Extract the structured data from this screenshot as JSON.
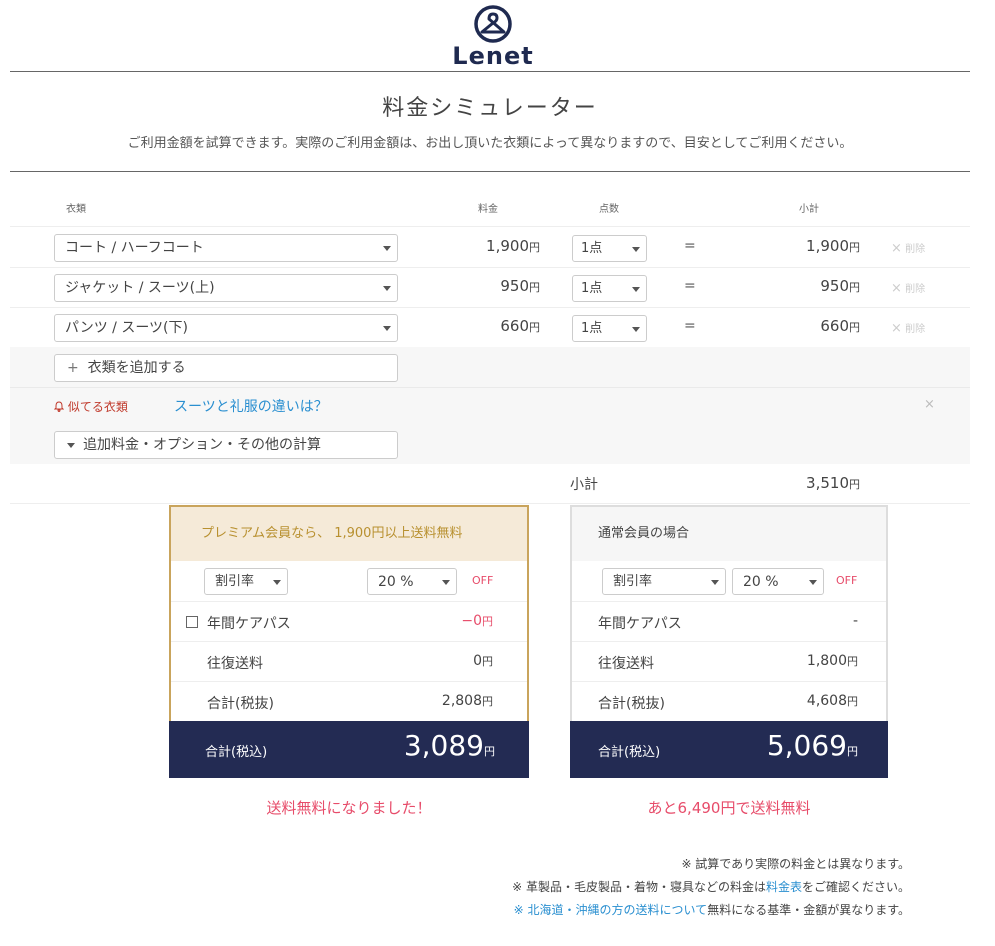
{
  "brand": {
    "name": "Lenet"
  },
  "page": {
    "title": "料金シミュレーター",
    "subtitle": "ご利用金額を試算できます。実際のご利用金額は、お出し頂いた衣類によって異なりますので、目安としてご利用ください。"
  },
  "table": {
    "headers": {
      "item": "衣類",
      "price": "料金",
      "count": "点数",
      "subtotal": "小計"
    },
    "rows": [
      {
        "item": "コート / ハーフコート",
        "price": "1,900",
        "count": "1点",
        "subtotal": "1,900"
      },
      {
        "item": "ジャケット / スーツ(上)",
        "price": "950",
        "count": "1点",
        "subtotal": "950"
      },
      {
        "item": "パンツ / スーツ(下)",
        "price": "660",
        "count": "1点",
        "subtotal": "660"
      }
    ],
    "equals": "=",
    "yen": "円",
    "delete_label": "削除",
    "delete_x": "×"
  },
  "add_item": {
    "plus": "+",
    "label": "衣類を追加する"
  },
  "similar": {
    "label": "似てる衣類",
    "link": "スーツと礼服の違いは？",
    "close": "×"
  },
  "additional": {
    "label": "追加料金・オプション・その他の計算"
  },
  "subtotal": {
    "label": "小計",
    "value": "3,510"
  },
  "premium": {
    "header": "プレミアム会員なら、 1,900円以上送料無料",
    "discount_label": "割引率",
    "discount_value": "20 %",
    "off": "OFF",
    "care_pass_label": "年間ケアパス",
    "care_pass_value": "−0",
    "shipping_label": "往復送料",
    "shipping_value": "0",
    "total_ex_label": "合計(税抜)",
    "total_ex_value": "2,808",
    "total_in_label": "合計(税込)",
    "total_in_value": "3,089",
    "message": "送料無料になりました！"
  },
  "normal": {
    "header": "通常会員の場合",
    "discount_label": "割引率",
    "discount_value": "20 %",
    "off": "OFF",
    "care_pass_label": "年間ケアパス",
    "care_pass_value": "-",
    "shipping_label": "往復送料",
    "shipping_value": "1,800",
    "total_ex_label": "合計(税抜)",
    "total_ex_value": "4,608",
    "total_in_label": "合計(税込)",
    "total_in_value": "5,069",
    "message": "あと6,490円で送料無料"
  },
  "notes": {
    "note1": "※ 試算であり実際の料金とは異なります。",
    "note2_pre": "※ 革製品・毛皮製品・着物・寝具などの料金は",
    "note2_link": "料金表",
    "note2_post": "をご確認ください。",
    "note3_kome": "※",
    "note3_link": "北海道・沖縄の方の送料について",
    "note3_post": "無料になる基準・金額が異なります。"
  },
  "colors": {
    "navy": "#232b53",
    "gold": "#c9a45c",
    "pink": "#e74c6a",
    "link": "#2a8fd0"
  }
}
